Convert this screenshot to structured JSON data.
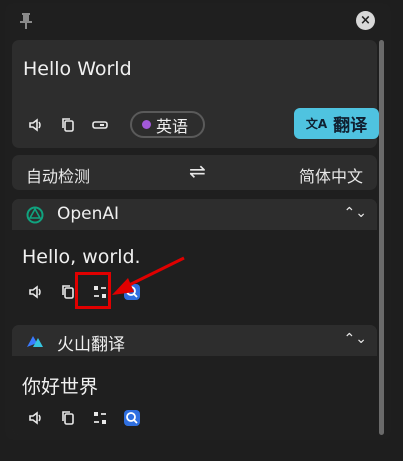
{
  "input": {
    "text": "Hello World",
    "language_label": "英语",
    "translate_label": "翻译"
  },
  "language_bar": {
    "source": "自动检测",
    "swap_glyph": "⇌",
    "target": "简体中文"
  },
  "results": [
    {
      "service": "OpenAI",
      "text": "Hello, world."
    },
    {
      "service": "火山翻译",
      "text": "你好世界"
    }
  ],
  "colors": {
    "accent": "#4fc3e0",
    "language_dot": "#a259d9",
    "openai_logo": "#10a37f",
    "annotation": "#e00000"
  },
  "icons": [
    "pin-icon",
    "close-icon",
    "speaker-icon",
    "copy-icon",
    "link-icon",
    "translate-icon",
    "swap-icon",
    "openai-logo-icon",
    "collapse-icon",
    "swap-text-icon",
    "search-icon",
    "volcano-logo-icon"
  ]
}
